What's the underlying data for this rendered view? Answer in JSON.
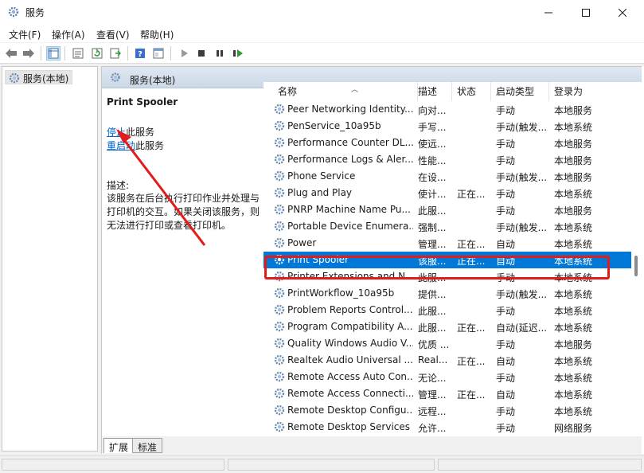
{
  "window": {
    "title": "服务",
    "icon": "gear-icon"
  },
  "menu": [
    {
      "label": "文件(F)"
    },
    {
      "label": "操作(A)"
    },
    {
      "label": "查看(V)"
    },
    {
      "label": "帮助(H)"
    }
  ],
  "toolbar": {
    "buttons": [
      "back-arrow-icon",
      "forward-arrow-icon",
      "show-hide-tree-icon",
      "properties-icon",
      "refresh-icon",
      "export-list-icon",
      "help-icon",
      "view-icon",
      "play-icon",
      "stop-icon",
      "pause-icon",
      "restart-icon"
    ]
  },
  "tree": {
    "node_label": "服务(本地)"
  },
  "content": {
    "header": "服务(本地)",
    "selected_service": "Print Spooler",
    "stop_link": "停止",
    "stop_suffix": "此服务",
    "restart_link": "重启动",
    "restart_suffix": "此服务",
    "desc_label": "描述:",
    "desc_text": "该服务在后台执行打印作业并处理与打印机的交互。如果关闭该服务，则无法进行打印或查看打印机。"
  },
  "columns": {
    "name": "名称",
    "desc": "描述",
    "status": "状态",
    "start_type": "启动类型",
    "logon": "登录为"
  },
  "rows": [
    {
      "name": "Peer Networking Identity...",
      "desc": "向对...",
      "status": "",
      "start": "手动",
      "logon": "本地服务"
    },
    {
      "name": "PenService_10a95b",
      "desc": "手写...",
      "status": "",
      "start": "手动(触发...",
      "logon": "本地系统"
    },
    {
      "name": "Performance Counter DL...",
      "desc": "使远...",
      "status": "",
      "start": "手动",
      "logon": "本地服务"
    },
    {
      "name": "Performance Logs & Aler...",
      "desc": "性能...",
      "status": "",
      "start": "手动",
      "logon": "本地服务"
    },
    {
      "name": "Phone Service",
      "desc": "在设...",
      "status": "",
      "start": "手动(触发...",
      "logon": "本地服务"
    },
    {
      "name": "Plug and Play",
      "desc": "使计...",
      "status": "正在...",
      "start": "手动",
      "logon": "本地系统"
    },
    {
      "name": "PNRP Machine Name Pu...",
      "desc": "此服...",
      "status": "",
      "start": "手动",
      "logon": "本地服务"
    },
    {
      "name": "Portable Device Enumera...",
      "desc": "强制...",
      "status": "",
      "start": "手动(触发...",
      "logon": "本地系统"
    },
    {
      "name": "Power",
      "desc": "管理...",
      "status": "正在...",
      "start": "自动",
      "logon": "本地系统"
    },
    {
      "name": "Print Spooler",
      "desc": "该服...",
      "status": "正在...",
      "start": "自动",
      "logon": "本地系统"
    },
    {
      "name": "Printer Extensions and N...",
      "desc": "此服...",
      "status": "",
      "start": "手动",
      "logon": "本地系统"
    },
    {
      "name": "PrintWorkflow_10a95b",
      "desc": "提供...",
      "status": "",
      "start": "手动(触发...",
      "logon": "本地系统"
    },
    {
      "name": "Problem Reports Control...",
      "desc": "此服...",
      "status": "",
      "start": "手动",
      "logon": "本地系统"
    },
    {
      "name": "Program Compatibility A...",
      "desc": "此服...",
      "status": "正在...",
      "start": "自动(延迟...",
      "logon": "本地系统"
    },
    {
      "name": "Quality Windows Audio V...",
      "desc": "优质 ...",
      "status": "",
      "start": "手动",
      "logon": "本地服务"
    },
    {
      "name": "Realtek Audio Universal ...",
      "desc": "Real...",
      "status": "正在...",
      "start": "自动",
      "logon": "本地系统"
    },
    {
      "name": "Remote Access Auto Con...",
      "desc": "无论...",
      "status": "",
      "start": "手动",
      "logon": "本地系统"
    },
    {
      "name": "Remote Access Connecti...",
      "desc": "管理...",
      "status": "正在...",
      "start": "自动",
      "logon": "本地系统"
    },
    {
      "name": "Remote Desktop Configu...",
      "desc": "远程...",
      "status": "",
      "start": "手动",
      "logon": "本地系统"
    },
    {
      "name": "Remote Desktop Services",
      "desc": "允许...",
      "status": "",
      "start": "手动",
      "logon": "网络服务"
    }
  ],
  "tabs": [
    {
      "label": "扩展"
    },
    {
      "label": "标准"
    }
  ],
  "colors": {
    "selection": "#0078d7",
    "highlight_box": "#e21b1b",
    "link": "#0066cc"
  }
}
